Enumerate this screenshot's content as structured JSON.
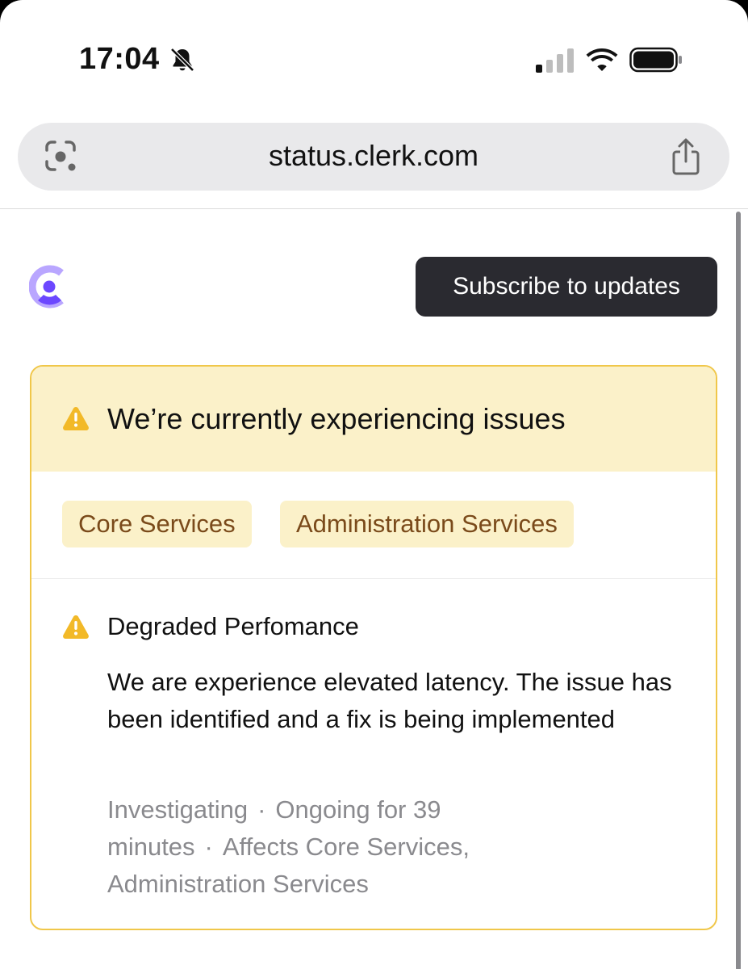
{
  "status_bar": {
    "time": "17:04",
    "icons": [
      "bell-slash-icon",
      "cellular-signal-icon",
      "wifi-icon",
      "battery-icon"
    ]
  },
  "browser": {
    "url": "status.clerk.com",
    "icons": [
      "lens-icon",
      "share-icon"
    ]
  },
  "header": {
    "logo_icon": "clerk-logo-icon",
    "subscribe_label": "Subscribe to updates"
  },
  "banner": {
    "title": "We’re currently experiencing issues",
    "icon": "warning-icon",
    "affected": [
      "Core Services",
      "Administration Services"
    ]
  },
  "incident": {
    "title": "Degraded Perfomance",
    "description": "We are experience elevated latency. The issue has been identified and a fix is being implemented",
    "status": "Investigating",
    "duration": "Ongoing for 39 minutes",
    "affects": "Affects Core Services, Administration Services"
  },
  "colors": {
    "banner_bg": "#fbf1c9",
    "card_border": "#f0c74a",
    "warning": "#f2b928",
    "tag_text": "#7a4a1a",
    "button_bg": "#2a2a30",
    "brand": "#6c47ff"
  }
}
